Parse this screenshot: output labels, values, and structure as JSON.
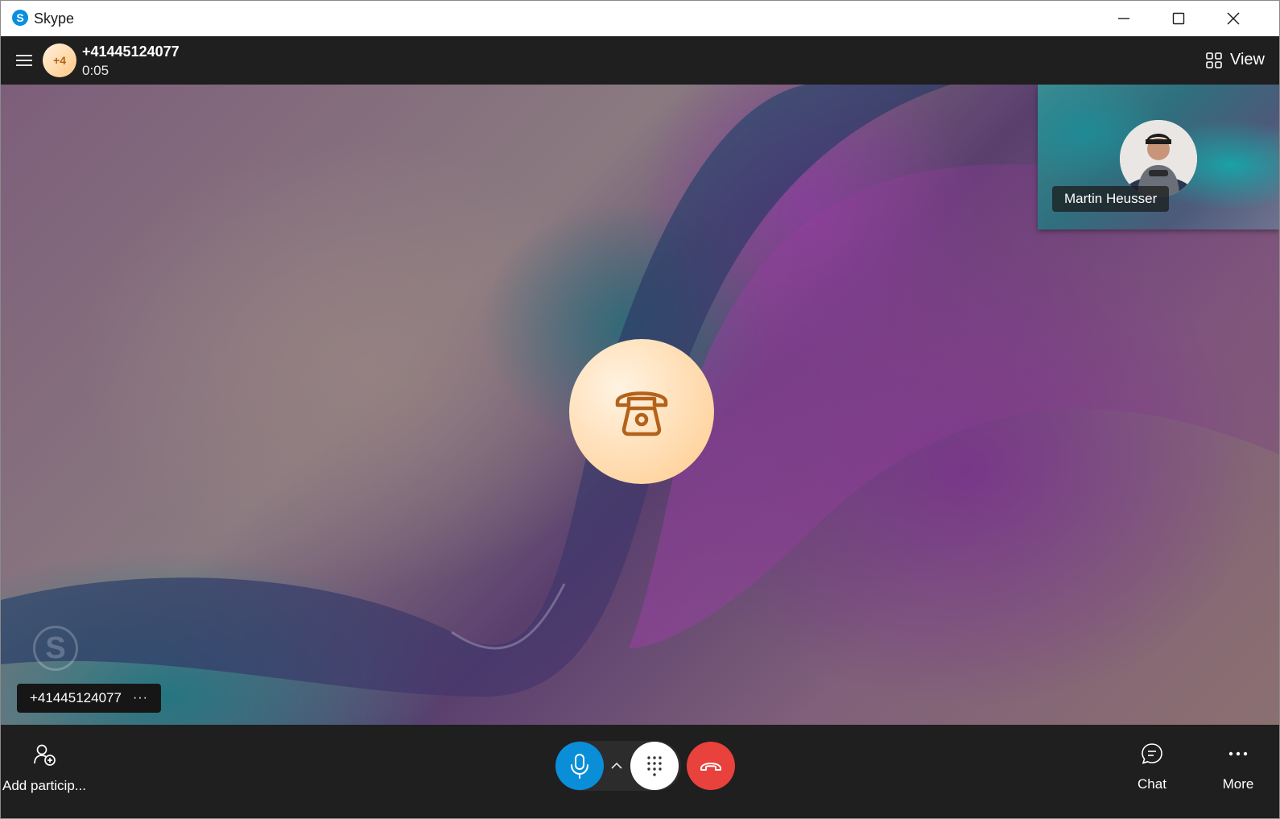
{
  "window": {
    "app_title": "Skype",
    "logo_letter": "S"
  },
  "call": {
    "participants_badge": "+4",
    "number": "+41445124077",
    "timer": "0:05",
    "view_label": "View"
  },
  "stage": {
    "watermark_letter": "S",
    "participant_tag": "+41445124077",
    "participant_tag_more": "···",
    "pip_name": "Martin Heusser"
  },
  "bottom": {
    "add_participant_label": "Add particip...",
    "chat_label": "Chat",
    "more_label": "More"
  },
  "colors": {
    "mic_active": "#0b8ed8",
    "hangup": "#e9413b",
    "avatar_accent": "#b4621a",
    "toolbar_bg": "#1f1f1f"
  },
  "icons": [
    "menu-icon",
    "grid-view-icon",
    "phone-icon",
    "add-person-icon",
    "microphone-icon",
    "chevron-up-icon",
    "dialpad-icon",
    "hang-up-icon",
    "chat-icon",
    "more-icon"
  ]
}
